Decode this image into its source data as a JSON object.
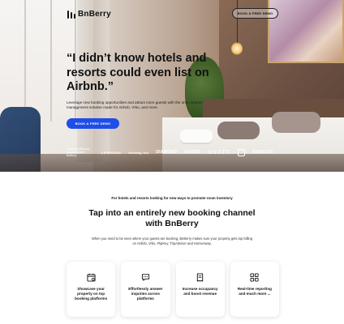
{
  "brand": {
    "name": "BnBerry",
    "logo_icon": "bnberry-logo-icon"
  },
  "header": {
    "cta_label": "BOOK A FREE DEMO"
  },
  "hero": {
    "headline": "“I didn’t know hotels and resorts could even list on Airbnb.”",
    "subtext": "Leverage new booking opportunities and attract more guests with the only channel management solution made for Airbnb, Vrbo, and more.",
    "cta_label": "BOOK A FREE DEMO",
    "logos_lead": "Leading hotels and resorts choose BnBerry",
    "logos": [
      "LEVERAGE",
      "Holiday Inn",
      "DIAMOND",
      "ROOMS",
      "HYATT",
      "SONESTA"
    ]
  },
  "section": {
    "eyebrow": "For hotels and resorts looking for new ways to promote room inventory",
    "title": "Tap into an entirely new booking channel with BnBerry",
    "text": "When you need to be seen where your guests are booking, BnBerry makes sure your property gets top billing on Airbnb, Vrbo, FlipKey, TripAdvisor and HomeAway."
  },
  "features": [
    {
      "icon": "calendar-icon",
      "label": "Showcase your property on top booking platforms"
    },
    {
      "icon": "chat-bubble-icon",
      "label": "Effortlessly answer inquiries across platforms"
    },
    {
      "icon": "invoice-icon",
      "label": "Increase occupancy and boost revenue"
    },
    {
      "icon": "grid-icon",
      "label": "Real-time reporting and much more ..."
    }
  ],
  "colors": {
    "accent": "#1f4de8",
    "text": "#111111"
  }
}
